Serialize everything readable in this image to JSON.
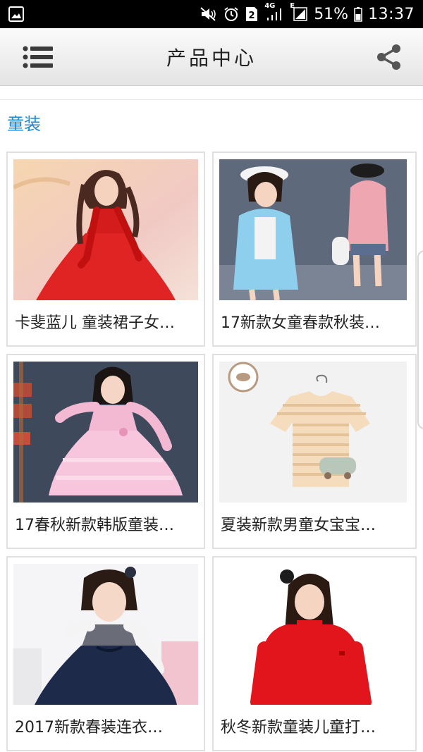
{
  "status_bar": {
    "network": "4G",
    "network_type": "E",
    "sim": "2",
    "battery": "51%",
    "time": "13:37"
  },
  "header": {
    "title": "产品中心",
    "menu_icon": "menu-icon",
    "share_icon": "share-icon"
  },
  "section": {
    "title": "童装"
  },
  "products": [
    {
      "name": "卡斐蓝儿 童装裙子女…",
      "image": "red-dress-girl"
    },
    {
      "name": "17新款女童春款秋装…",
      "image": "blue-pink-jackets"
    },
    {
      "name": "17春秋新款韩版童装…",
      "image": "pink-tulle-dress"
    },
    {
      "name": "夏装新款男童女宝宝…",
      "image": "striped-car-tshirt"
    },
    {
      "name": "2017新款春装连衣…",
      "image": "navy-tulle-dress"
    },
    {
      "name": "秋冬新款童装儿童打…",
      "image": "red-sweater-girl"
    }
  ],
  "colors": {
    "accent": "#1a8bd2",
    "status_bar": "#000000",
    "header_bg": "#eeeeee"
  }
}
